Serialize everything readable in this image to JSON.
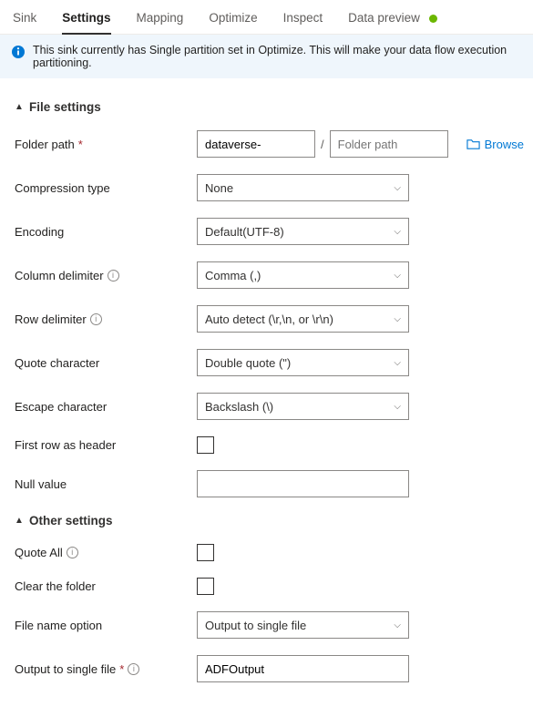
{
  "tabs": {
    "sink": "Sink",
    "settings": "Settings",
    "mapping": "Mapping",
    "optimize": "Optimize",
    "inspect": "Inspect",
    "dataPreview": "Data preview"
  },
  "banner": {
    "message": "This sink currently has Single partition set in Optimize. This will make your data flow execution partitioning."
  },
  "sections": {
    "fileSettings": "File settings",
    "otherSettings": "Other settings"
  },
  "labels": {
    "folderPath": "Folder path",
    "compressionType": "Compression type",
    "encoding": "Encoding",
    "columnDelimiter": "Column delimiter",
    "rowDelimiter": "Row delimiter",
    "quoteCharacter": "Quote character",
    "escapeCharacter": "Escape character",
    "firstRowAsHeader": "First row as header",
    "nullValue": "Null value",
    "quoteAll": "Quote All",
    "clearTheFolder": "Clear the folder",
    "fileNameOption": "File name option",
    "outputToSingleFile": "Output to single file"
  },
  "values": {
    "folderPath1": "dataverse-",
    "folderPath2Placeholder": "Folder path",
    "compressionType": "None",
    "encoding": "Default(UTF-8)",
    "columnDelimiter": "Comma (,)",
    "rowDelimiter": "Auto detect (\\r,\\n, or \\r\\n)",
    "quoteCharacter": "Double quote (\")",
    "escapeCharacter": "Backslash (\\)",
    "nullValue": "",
    "fileNameOption": "Output to single file",
    "outputToSingleFile": "ADFOutput"
  },
  "actions": {
    "browse": "Browse"
  }
}
